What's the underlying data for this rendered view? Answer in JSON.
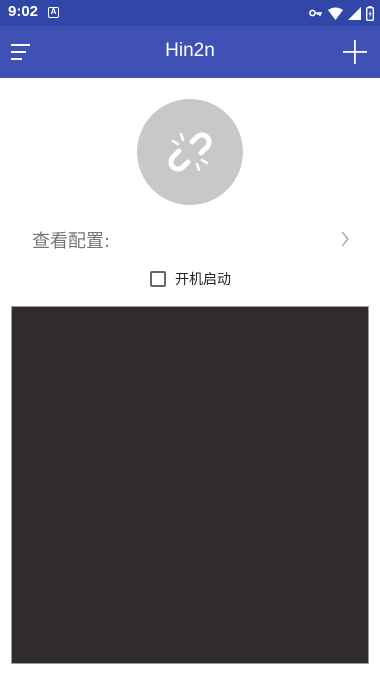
{
  "status_bar": {
    "time": "9:02",
    "notification_icon": "a-icon",
    "right_icons": [
      "vpn-key-icon",
      "wifi-icon",
      "signal-icon",
      "battery-icon"
    ]
  },
  "app_bar": {
    "title": "Hin2n",
    "menu_icon": "menu-icon",
    "add_icon": "add-icon",
    "color": "#3f51b5",
    "status_color": "#3047a8"
  },
  "connect": {
    "icon": "broken-link-icon",
    "state": "disconnected"
  },
  "config": {
    "label": "查看配置:"
  },
  "autostart": {
    "label": "开机启动",
    "checked": false
  },
  "log": {
    "text": ""
  }
}
